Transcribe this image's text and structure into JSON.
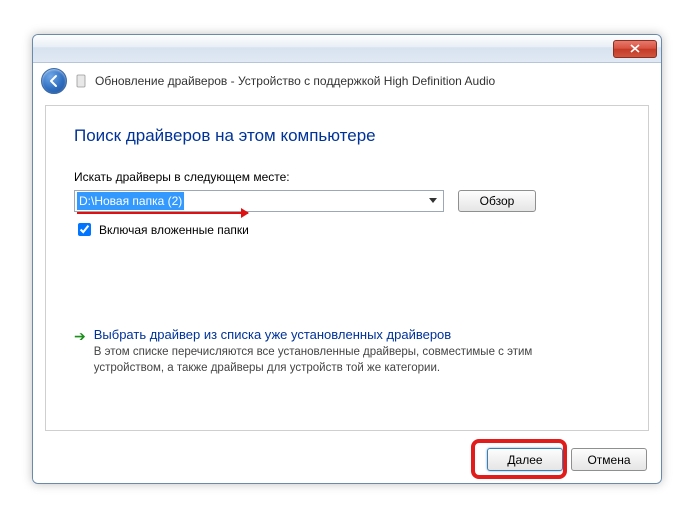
{
  "window": {
    "title": "Обновление драйверов - Устройство с поддержкой High Definition Audio"
  },
  "content": {
    "headline": "Поиск драйверов на этом компьютере",
    "field_label": "Искать драйверы в следующем месте:",
    "path_value": "D:\\Новая папка (2)",
    "browse_label": "Обзор",
    "checkbox_label": "Включая вложенные папки",
    "option": {
      "title": "Выбрать драйвер из списка уже установленных драйверов",
      "desc": "В этом списке перечисляются все установленные драйверы, совместимые с этим устройством, а также драйверы для устройств той же категории."
    }
  },
  "buttons": {
    "next": "Далее",
    "cancel": "Отмена"
  }
}
